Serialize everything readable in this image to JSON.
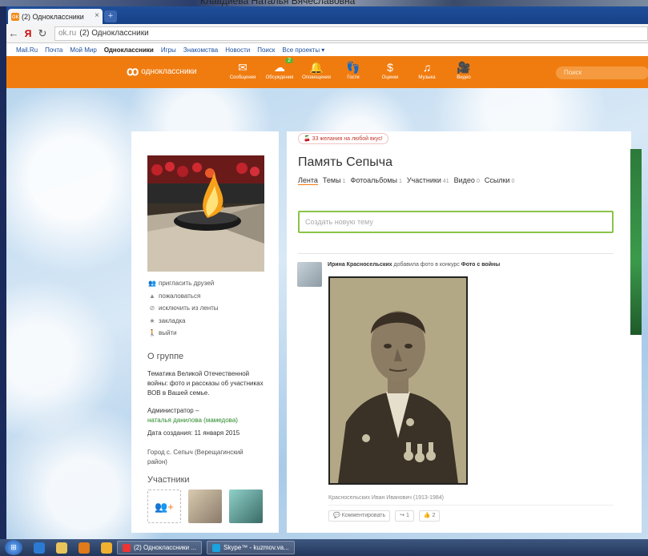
{
  "desktop_top_text": "Клавдиева Наталья Вячеславовна",
  "browser": {
    "tab_title": "(2) Одноклассники",
    "tab_close": "×",
    "new_tab": "+",
    "back": "←",
    "yandex": "Я",
    "reload": "↻",
    "url_domain": "ok.ru",
    "url_title": "(2) Одноклассники"
  },
  "mailru_links": [
    "Mail.Ru",
    "Почта",
    "Мой Мир",
    "Одноклассники",
    "Игры",
    "Знакомства",
    "Новости",
    "Поиск",
    "Все проекты ▾"
  ],
  "ok_header": {
    "logo_text": "одноклассники",
    "nav": [
      {
        "glyph": "✉",
        "label": "Сообщения"
      },
      {
        "glyph": "☁",
        "label": "Обсуждения",
        "badge": "2"
      },
      {
        "glyph": "🔔",
        "label": "Оповещения"
      },
      {
        "glyph": "👣",
        "label": "Гости"
      },
      {
        "glyph": "$",
        "label": "Оценки"
      },
      {
        "glyph": "♫",
        "label": "Музыка"
      },
      {
        "glyph": "🎥",
        "label": "Видео"
      }
    ],
    "search_placeholder": "Поиск"
  },
  "group": {
    "wish_badge": "33 желания на любой вкус!",
    "title": "Память Сепыча",
    "tabs": [
      {
        "label": "Лента",
        "count": ""
      },
      {
        "label": "Темы",
        "count": "1"
      },
      {
        "label": "Фотоальбомы",
        "count": "1"
      },
      {
        "label": "Участники",
        "count": "41"
      },
      {
        "label": "Видео",
        "count": "0"
      },
      {
        "label": "Ссылки",
        "count": "0"
      }
    ],
    "new_topic_placeholder": "Создать новую тему",
    "actions": [
      {
        "icon": "👥",
        "label": "пригласить друзей"
      },
      {
        "icon": "▲",
        "label": "пожаловаться"
      },
      {
        "icon": "⊘",
        "label": "исключить из ленты"
      },
      {
        "icon": "★",
        "label": "закладка"
      },
      {
        "icon": "🚶",
        "label": "выйти"
      }
    ],
    "about_title": "О группе",
    "about_text": "Тематика Великой Отечественной войны: фото и рассказы об участниках ВОВ в Вашей семье.",
    "admin_label": "Администратор –",
    "admin_name": "наталья данилова (мамедова)",
    "created": "Дата создания: 11 января 2015",
    "city": "Город с. Сепыч (Верещагинский район)",
    "members_title": "Участники"
  },
  "post": {
    "author": "Ирина Красносельских",
    "action": "добавила фото в конкурс",
    "contest": "Фото с войны",
    "caption": "Красносельских Иван Иванович (1913-1984)",
    "btn_comment": "Комментировать",
    "btn_share_count": "1",
    "btn_like_count": "2"
  },
  "taskbar": {
    "start": "⊞",
    "task1": "(2) Одноклассники ...",
    "task2": "Skype™ - kuzmov.va..."
  },
  "colors": {
    "ok_orange": "#f07c10",
    "green_accent": "#8bc34a"
  }
}
